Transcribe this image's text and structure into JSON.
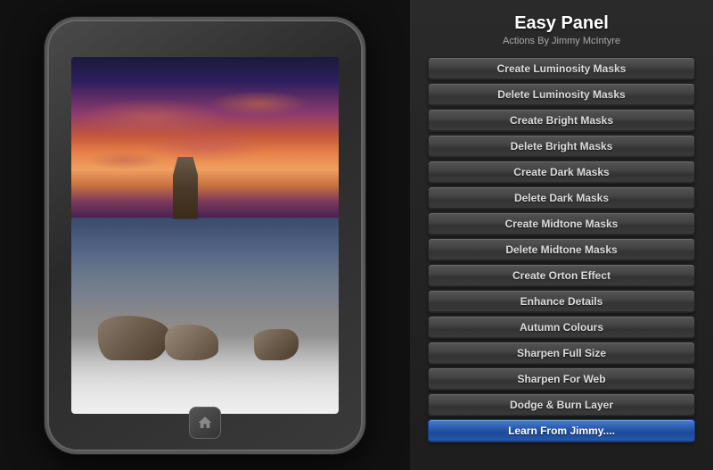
{
  "panel": {
    "title": "Easy Panel",
    "subtitle": "Actions By Jimmy McIntyre",
    "buttons": [
      {
        "label": "Create Luminosity Masks",
        "highlight": false
      },
      {
        "label": "Delete Luminosity Masks",
        "highlight": false
      },
      {
        "label": "Create Bright Masks",
        "highlight": false
      },
      {
        "label": "Delete Bright Masks",
        "highlight": false
      },
      {
        "label": "Create Dark Masks",
        "highlight": false
      },
      {
        "label": "Delete Dark Masks",
        "highlight": false
      },
      {
        "label": "Create Midtone Masks",
        "highlight": false
      },
      {
        "label": "Delete Midtone Masks",
        "highlight": false
      },
      {
        "label": "Create Orton Effect",
        "highlight": false
      },
      {
        "label": "Enhance Details",
        "highlight": false
      },
      {
        "label": "Autumn Colours",
        "highlight": false
      },
      {
        "label": "Sharpen Full Size",
        "highlight": false
      },
      {
        "label": "Sharpen For Web",
        "highlight": false
      },
      {
        "label": "Dodge & Burn Layer",
        "highlight": false
      },
      {
        "label": "Learn From Jimmy....",
        "highlight": true
      }
    ]
  },
  "ipad": {
    "home_button_label": "home"
  }
}
